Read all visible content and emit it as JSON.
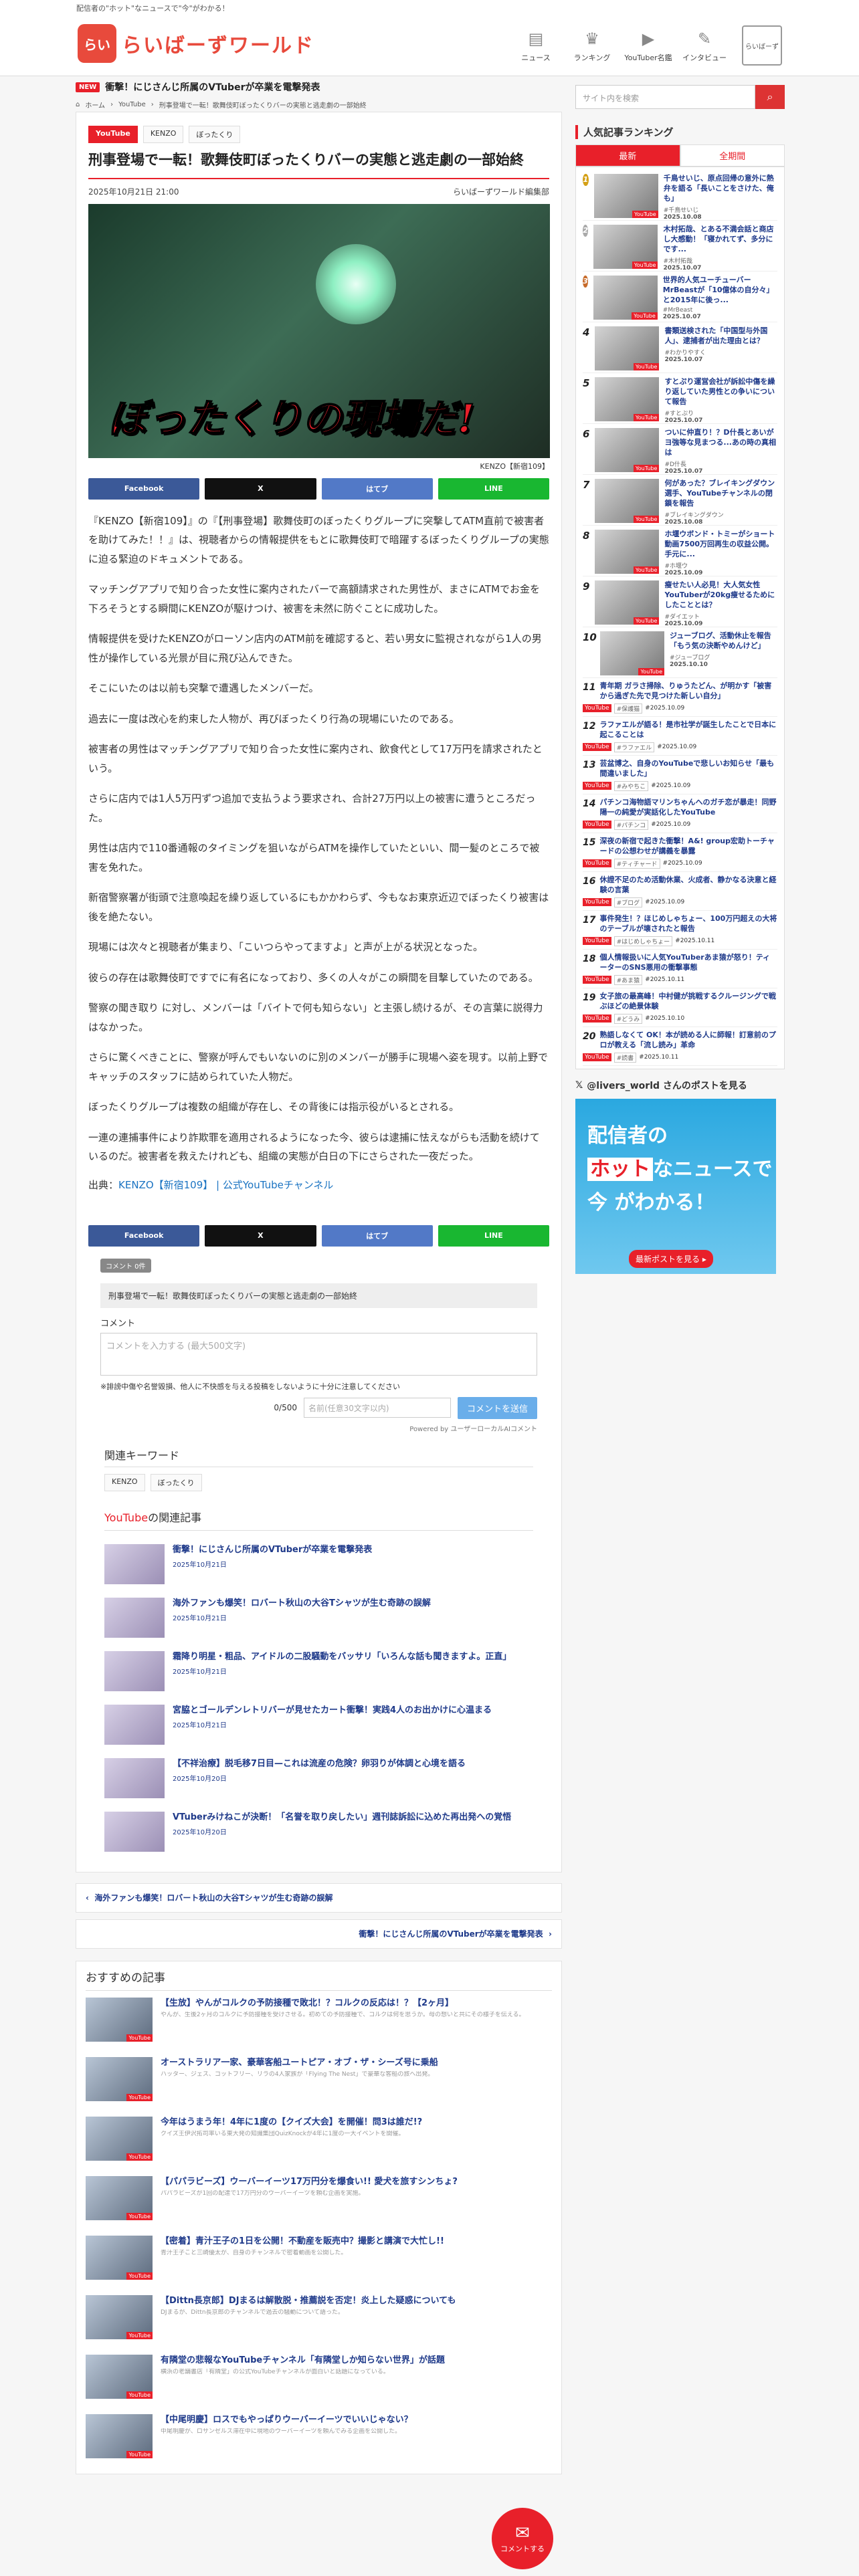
{
  "topbar": {
    "tagline": "配信者の\"ホット\"なニュースで\"今\"がわかる！"
  },
  "logo": {
    "mark": "らい",
    "text": "らいばーずワールド",
    "sub": "配信者の\"ホット\"なニュースで\"今\"がわかる！"
  },
  "nav": [
    {
      "label": "ニュース",
      "icon": "▤"
    },
    {
      "label": "ランキング",
      "icon": "♛"
    },
    {
      "label": "YouTuber名鑑",
      "icon": "▶"
    },
    {
      "label": "インタビュー",
      "icon": "✎"
    }
  ],
  "nav_mag": "らいばーず",
  "news": {
    "tag": "NEW",
    "text": "衝撃！にじさんじ所属のVTuberが卒業を電撃発表"
  },
  "breadcrumb": [
    "ホーム",
    "YouTube",
    "刑事登場で一転！歌舞伎町ぼったくりバーの実態と逃走劇の一部始終"
  ],
  "article": {
    "tags": [
      "YouTube",
      "KENZO",
      "ぼったくり"
    ],
    "title": "刑事登場で一転！歌舞伎町ぼったくりバーの実態と逃走劇の一部始終",
    "date": "2025年10月21日 21:00",
    "author": "らいばーずワールド編集部",
    "hero_caption": "ぼったくりの現場だ!",
    "credit": "KENZO【新宿109】",
    "paragraphs": [
      "『KENZO【新宿109】』の『【刑事登場】歌舞伎町のぼったくりグループに突撃してATM直前で被害者を助けてみた！！』は、視聴者からの情報提供をもとに歌舞伎町で暗躍するぼったくりグループの実態に迫る緊迫のドキュメントである。",
      "マッチングアプリで知り合った女性に案内されたバーで高額請求された男性が、まさにATMでお金を下ろそうとする瞬間にKENZOが駆けつけ、被害を未然に防ぐことに成功した。",
      "情報提供を受けたKENZOがローソン店内のATM前を確認すると、若い男女に監視されながら1人の男性が操作している光景が目に飛び込んできた。",
      "そこにいたのは以前も突撃で遭遇したメンバーだ。",
      "過去に一度は改心を約束した人物が、再びぼったくり行為の現場にいたのである。",
      "被害者の男性はマッチングアプリで知り合った女性に案内され、飲食代として17万円を請求されたという。",
      "さらに店内では1人5万円ずつ追加で支払うよう要求され、合計27万円以上の被害に遭うところだった。",
      "男性は店内で110番通報のタイミングを狙いながらATMを操作していたといい、間一髪のところで被害を免れた。",
      "新宿警察署が街頭で注意喚起を繰り返しているにもかかわらず、今もなお東京近辺でぼったくり被害は後を絶たない。",
      "現場には次々と視聴者が集まり、「こいつらやってますよ」と声が上がる状況となった。",
      "彼らの存在は歌舞伎町ですでに有名になっており、多くの人々がこの瞬間を目撃していたのである。",
      "警察の聞き取り に対し、メンバーは「バイトで何も知らない」と主張し続けるが、その言葉に説得力はなかった。",
      "さらに驚くべきことに、警察が呼んでもいないのに別のメンバーが勝手に現場へ姿を現す。以前上野でキャッチのスタッフに詰められていた人物だ。",
      "ぼったくりグループは複数の組織が存在し、その背後には指示役がいるとされる。",
      "一連の連捕事件により詐欺罪を適用されるようになった今、彼らは逮捕に怯えながらも活動を続けているのだ。被害者を救えたけれども、組織の実態が白日の下にさらされた一夜だった。"
    ],
    "source_label": "出典：",
    "source_link": "KENZO【新宿109】 | 公式YouTubeチャンネル"
  },
  "share": {
    "facebook": "Facebook",
    "x": "X",
    "hatena": "はてブ",
    "line": "LINE"
  },
  "comment": {
    "badge": "コメント 0件",
    "title": "刑事登場で一転！歌舞伎町ぼったくりバーの実態と逃走劇の一部始終",
    "label": "コメント",
    "placeholder": "コメントを入力する (最大500文字)",
    "note": "※誹謗中傷や名誉毀損、他人に不快感を与える投稿をしないように十分に注意してください",
    "count": "0/500",
    "name_placeholder": "名前(任意30文字以内)",
    "submit": "コメントを送信",
    "powered": "Powered by ユーザーローカルAIコメント"
  },
  "keywords": {
    "title": "関連キーワード",
    "items": [
      "KENZO",
      "ぼったくり"
    ]
  },
  "related": {
    "title_accent": "YouTube",
    "title_rest": "の関連記事",
    "items": [
      {
        "title": "衝撃！にじさんじ所属のVTuberが卒業を電撃発表",
        "date": "2025年10月21日"
      },
      {
        "title": "海外ファンも爆笑！ロバート秋山の大谷Tシャツが生む奇跡の誤解",
        "date": "2025年10月21日"
      },
      {
        "title": "霜降り明星・粗品、アイドルの二股騒動をバッサリ「いろんな話も聞きますよ。正直」",
        "date": "2025年10月21日"
      },
      {
        "title": "宮脇とゴールデンレトリバーが見せたカート衝撃！実践4人のお出かけに心温まる",
        "date": "2025年10月21日"
      },
      {
        "title": "【不祥治療】脱毛移7日目—これは流産の危険？卵羽りが体調と心境を語る",
        "date": "2025年10月20日"
      },
      {
        "title": "VTuberみけねこが決断！「名誉を取り戻したい」週刊誌訴訟に込めた再出発への覚悟",
        "date": "2025年10月20日"
      }
    ]
  },
  "pager": {
    "prev": "海外ファンも爆笑！ロバート秋山の大谷Tシャツが生む奇跡の誤解",
    "next": "衝撃！にじさんじ所属のVTuberが卒業を電撃発表"
  },
  "recommend": {
    "title": "おすすめの記事",
    "items": [
      {
        "title": "【生放】やんがコルクの予防接種で敗北！？コルクの反応は！？【2ヶ月】",
        "desc": "やんが、生後2ヶ月のコルクに予防接種を受けさせる。初めての予防接種で、コルクは何を思うか。母の想いと共にその様子を伝える。"
      },
      {
        "title": "オーストラリア一家、豪華客船ユートピア・オブ・ザ・シーズ号に乗船",
        "desc": "ハッター、ジェス、コットフリー、リラの4人家族が「Flying The Nest」で豪華な客船の旅へ出発。"
      },
      {
        "title": "今年はうまう年！4年に1度の【クイズ大会】を開催！問3は誰だ!?",
        "desc": "クイズ王伊沢拓司率いる東大発の知識集団QuizKnockが4年に1度の一大イベントを開催。"
      },
      {
        "title": "【パパラビーズ】ウーバーイーツ17万円分を爆食い!! 愛犬を旅すシンちょ?",
        "desc": "パパラビーズが1回の配達で17万円分のウーバーイーツを頼む企画を実施。"
      },
      {
        "title": "【密着】青汁王子の1日を公開！不動産を販売中？撮影と講演で大忙し!!",
        "desc": "青汁王子こと三崎優太が、自身のチャンネルで密着動画を公開した。"
      },
      {
        "title": "【Dittn長京郎】DJまるは解散脱・推薦説を否定！炎上した疑惑についても",
        "desc": "DJまるが、Dittn長京郎のチャンネルで過去の騒動について語った。"
      },
      {
        "title": "有隣堂の悲報なYouTubeチャンネル「有隣堂しか知らない世界」が話題",
        "desc": "横浜の老舗書店「有隣堂」の公式YouTubeチャンネルが面白いと話題になっている。"
      },
      {
        "title": "【中尾明慶】ロスでもやっぱりウーバーイーツでいいじゃない？",
        "desc": "中尾明慶が、ロサンゼルス滞在中に現地のウーバーイーツを頼んでみる企画を公開した。"
      }
    ]
  },
  "search": {
    "placeholder": "サイト内を検索",
    "icon": "search-icon"
  },
  "ranking": {
    "title": "人気記事ランキング",
    "tab_latest": "最新",
    "tab_all": "全期間",
    "top": [
      {
        "n": "1",
        "title": "千鳥せいじ、原点回帰の意外に熱弁を語る「長いことをさけた、俺も」",
        "tag": "#千鳥せいじ",
        "date": "2025.10.08"
      },
      {
        "n": "2",
        "title": "木村拓哉、とある不満会話と商店し大感動！「寝かれてず、多分にです...",
        "tag": "#木村拓哉",
        "date": "2025.10.07"
      },
      {
        "n": "3",
        "title": "世界的人気ユーチューバーMrBeastが「10億体の自分々」と2015年に後っ...",
        "tag": "#MrBeast",
        "date": "2025.10.07"
      },
      {
        "n": "4",
        "title": "書類送検された「中国型与外国人」、逮捕者が出た理由とは？",
        "tag": "#わかりやすく",
        "date": "2025.10.07"
      },
      {
        "n": "5",
        "title": "すとぷり運営会社が訴訟中傷を繰り返していた男性との争いについて報告",
        "tag": "#すとぷり",
        "date": "2025.10.07"
      },
      {
        "n": "6",
        "title": "ついに仲直り！？D什長とあいがヨ強等な見まつる...あの時の真相は",
        "tag": "#D什長",
        "date": "2025.10.07"
      },
      {
        "n": "7",
        "title": "何があった？ブレイキングダウン選手、YouTubeチャンネルの閉鎖を報告",
        "tag": "#ブレイキングダウン",
        "date": "2025.10.08"
      },
      {
        "n": "8",
        "title": "ホ堰ウボンド・トミーがショート動画7500万回再生の収益公開。手元に...",
        "tag": "#ホ堰ウ",
        "date": "2025.10.09"
      },
      {
        "n": "9",
        "title": "瘦せたい人必見！大人気女性YouTuberが20kg痩せるためにしたこととは？",
        "tag": "#ダイエット",
        "date": "2025.10.09"
      },
      {
        "n": "10",
        "title": "ジューブログ、活動休止を報告「もう気の決断やめんけど」",
        "tag": "#ジューブログ",
        "date": "2025.10.10"
      }
    ],
    "rest": [
      {
        "n": "11",
        "title": "青年期 ガラさ掃除、りゅうたどん、が明かす「被害から過ぎた先で見つけた新しい自分」",
        "tag": "#保護猫",
        "date": "#2025.10.09"
      },
      {
        "n": "12",
        "title": "ラファエルが語る！是市社学が誕生したことで日本に起こることは",
        "tag": "#ラファエル",
        "date": "#2025.10.09"
      },
      {
        "n": "13",
        "title": "芸盆博之、自身のYouTubeで悲しいお知らせ「最も間違いました」",
        "tag": "#みやちこ",
        "date": "#2025.10.09"
      },
      {
        "n": "14",
        "title": "パチンコ海物語マリンちゃんへのガチ恋が暴走！同野陽一の純愛が実話化したYouTube",
        "tag": "#パチンコ",
        "date": "#2025.10.09"
      },
      {
        "n": "15",
        "title": "深夜の新宿で起きた衝撃！A&! group宏助トーチャードの公想わせが講義を暴露",
        "tag": "#ティチャード",
        "date": "#2025.10.09"
      },
      {
        "n": "16",
        "title": "休證不足のため活動休業、火成者、静かなる決意と経験の言葉",
        "tag": "#ブログ",
        "date": "#2025.10.09"
      },
      {
        "n": "17",
        "title": "事件発生！？ほじめしゃちょー、100万円超えの大将のテーブルが壊されたと報告",
        "tag": "#はじめしゃちょー",
        "date": "#2025.10.11"
      },
      {
        "n": "18",
        "title": "個人情報扱いに人気YouTuberあま猿が怒り！ティーターのSNS悪用の衝撃事態",
        "tag": "#あま猿",
        "date": "#2025.10.11"
      },
      {
        "n": "19",
        "title": "女子旅の最高峰！中村健が挑戦するクルージングで戦ぶほどの絶景体験",
        "tag": "#どうみ",
        "date": "#2025.10.10"
      },
      {
        "n": "20",
        "title": "熟語しなくて OK！本が読める人に師報！訂意前のプロが教える「流し読み」革命",
        "tag": "#読書",
        "date": "#2025.10.11"
      }
    ]
  },
  "xfeed": {
    "title": "@livers_world さんのポストを見る",
    "line1": "配信者の",
    "hot": "ホット",
    "line2": "なニュースで",
    "line3": "今 がわかる！",
    "cta": "最新ポストを見る ▸"
  },
  "fab": {
    "label": "コメントする"
  }
}
